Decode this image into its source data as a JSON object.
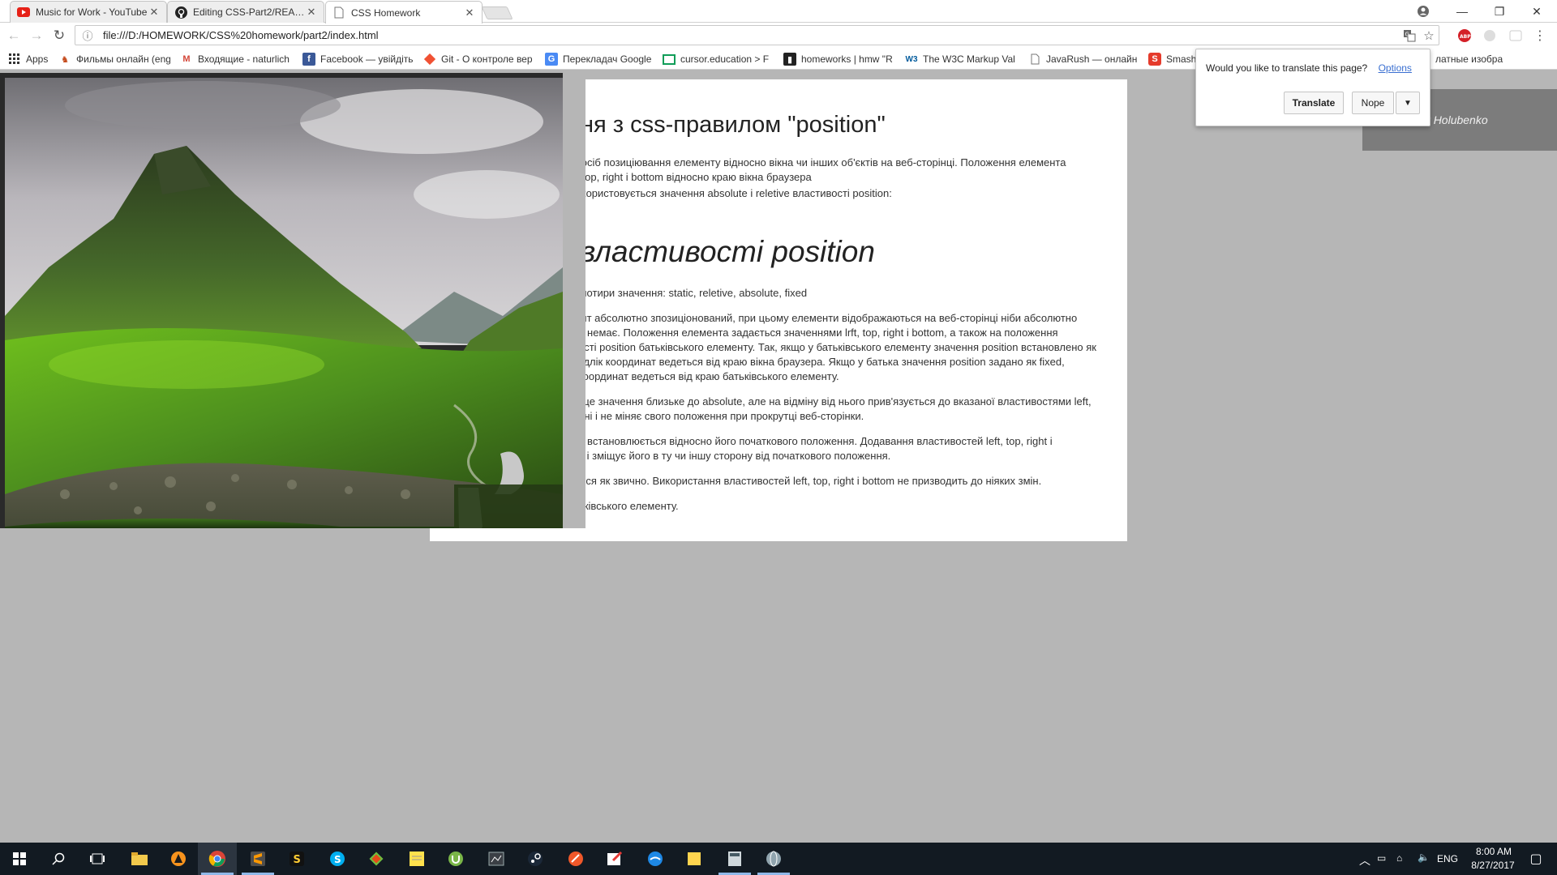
{
  "tabs": [
    {
      "title": "Music for Work - YouTube",
      "icon": "youtube-icon",
      "active": false
    },
    {
      "title": "Editing CSS-Part2/README",
      "icon": "github-icon",
      "active": false
    },
    {
      "title": "CSS Homework",
      "icon": "document-icon",
      "active": true
    }
  ],
  "toolbar": {
    "url": "file:///D:/HOMEWORK/CSS%20homework/part2/index.html"
  },
  "bookmarks": [
    {
      "label": "Apps",
      "icon": "apps-grid-icon"
    },
    {
      "label": "Фильмы онлайн (eng",
      "icon": "film-icon"
    },
    {
      "label": "Входящие - naturlich",
      "icon": "gmail-icon"
    },
    {
      "label": "Facebook — увійдіть",
      "icon": "facebook-icon"
    },
    {
      "label": "Git - О контроле вер",
      "icon": "git-icon"
    },
    {
      "label": "Перекладач Google",
      "icon": "google-translate-icon"
    },
    {
      "label": "cursor.education > F",
      "icon": "spreadsheet-icon"
    },
    {
      "label": "homeworks | hmw \"R",
      "icon": "bookmark-icon"
    },
    {
      "label": "The W3C Markup Val",
      "icon": "w3c-icon"
    },
    {
      "label": "JavaRush — онлайн-",
      "icon": "page-icon"
    },
    {
      "label": "Smash",
      "icon": "smashing-icon"
    },
    {
      "label": "латные изобра",
      "icon": "page-icon"
    }
  ],
  "translate_bubble": {
    "question": "Would you like to translate this page?",
    "options_link": "Options",
    "translate_button": "Translate",
    "nope_button": "Nope"
  },
  "page": {
    "heading1": "ння з css-правилом \"position\"",
    "intro_line1": "є спосіб позиціювання елементу відносно вікна чи інших об'єктів на веб-сторінці. Положення елемента\nleft, top, right і bottom відносно краю вікна браузера",
    "intro_line2": "т використовується значення absolute і reletive властивості position:",
    "heading2": "я властивості position",
    "values_line": "ати чотири значення: static, reletive, absolute, fixed",
    "absolute_para": "емент абсолютно зпозиціонований, при цьому елементи відображаються на веб-сторінці ніби абсолютно\nента немає. Положення елемента задається значеннями lrft, top, right і bottom, а також на положення\nтивості position батьківського елементу. Так, якщо у батьківського елементу значення position встановлено як\nто відлік координат ведеться від краю вікна браузера. Якщо у батька значення position задано як fixed,\nлік координат ведеться від краю батьківського елементу.",
    "fixed_para": "кою це значення близьке до absolute, але на відміну від нього прив'язується до вказаної властивостями left,\nекрані і не міняє свого положення при прокрутці веб-сторінки.",
    "relative_para": "ента встановлюється відносно його початкового положення. Додавання властивостей left, top, right і\nенту і зміщує його в ту чи іншу сторону від початкового положення.",
    "static_para": "аються як звичнo. Використання властивостей left, top, right і bottom не призводить до ніяких змін.",
    "inherit_para": "батьківського елементу.",
    "author": "Oleksandr Holubenko"
  },
  "taskbar": {
    "apps": [
      "file-explorer-icon",
      "avast-icon",
      "chrome-icon",
      "sublime-text-icon",
      "s-app-icon",
      "skype-icon",
      "app-icon",
      "sticky-notes-icon",
      "utorrent-icon",
      "app-window-icon",
      "steam-icon",
      "app-icon",
      "paint-icon",
      "app-icon",
      "sticky-notes-icon",
      "app-icon",
      "app-icon"
    ],
    "lang": "ENG",
    "time": "8:00 AM",
    "date": "8/27/2017"
  },
  "colors": {
    "page_bg": "#b6b6b6",
    "author_badge": "#7c7c7c",
    "taskbar": "#121a22",
    "link": "#3a6fd1"
  }
}
